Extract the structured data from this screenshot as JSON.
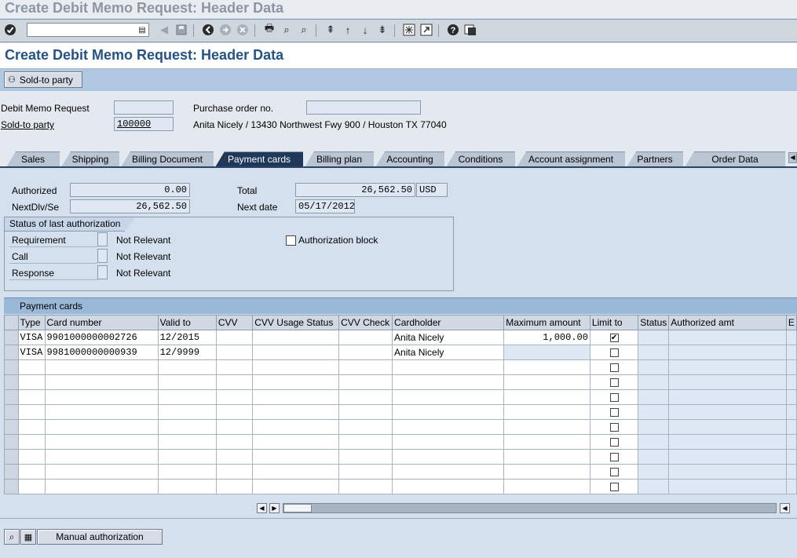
{
  "window_title": "Create Debit Memo Request: Header Data",
  "page_title": "Create Debit Memo Request: Header Data",
  "toolbar": {
    "command_field": "",
    "icons": [
      "enter-icon",
      "back-icon",
      "save-icon",
      "back-arrow-icon",
      "exit-icon",
      "cancel-icon",
      "print-icon",
      "find-icon",
      "find-next-icon",
      "first-page-icon",
      "previous-page-icon",
      "next-page-icon",
      "last-page-icon",
      "create-session-icon",
      "shortcut-icon",
      "help-icon",
      "layout-menu-icon"
    ]
  },
  "app_toolbar": {
    "sold_to_party_button": "Sold-to party"
  },
  "header": {
    "debit_memo_request_label": "Debit Memo Request",
    "debit_memo_request_value": "",
    "purchase_order_label": "Purchase order no.",
    "purchase_order_value": "",
    "sold_to_party_label": "Sold-to party",
    "sold_to_party_value": "100000",
    "sold_to_party_address": "Anita Nicely / 13430 Northwest Fwy 900 / Houston TX 77040"
  },
  "tabs": [
    {
      "label": "Sales",
      "active": false
    },
    {
      "label": "Shipping",
      "active": false
    },
    {
      "label": "Billing Document",
      "active": false
    },
    {
      "label": "Payment cards",
      "active": true
    },
    {
      "label": "Billing plan",
      "active": false
    },
    {
      "label": "Accounting",
      "active": false
    },
    {
      "label": "Conditions",
      "active": false
    },
    {
      "label": "Account assignment",
      "active": false
    },
    {
      "label": "Partners",
      "active": false
    },
    {
      "label": "Order Data",
      "active": false
    }
  ],
  "payment": {
    "authorized_label": "Authorized",
    "authorized_value": "0.00",
    "next_dlv_label": "NextDlv/Se",
    "next_dlv_value": "26,562.50",
    "total_label": "Total",
    "total_value": "26,562.50",
    "currency": "USD",
    "next_date_label": "Next date",
    "next_date_value": "05/17/2012"
  },
  "status_group": {
    "title": "Status of last authorization",
    "rows": [
      {
        "label": "Requirement",
        "value": "Not Relevant"
      },
      {
        "label": "Call",
        "value": "Not Relevant"
      },
      {
        "label": "Response",
        "value": "Not Relevant"
      }
    ],
    "authorization_block_label": "Authorization block",
    "authorization_block_checked": false
  },
  "cards_table": {
    "title": "Payment cards",
    "columns": [
      "Type",
      "Card number",
      "Valid to",
      "CVV",
      "CVV Usage Status",
      "CVV Check",
      "Cardholder",
      "Maximum amount",
      "Limit to",
      "Status",
      "Authorized amt",
      "E"
    ],
    "rows": [
      {
        "type": "VISA",
        "card_number": "9901000000002726",
        "valid_to": "12/2015",
        "cvv": "",
        "cvv_usage": "",
        "cvv_check": "",
        "cardholder": "Anita Nicely",
        "max_amount": "1,000.00",
        "limit_to": true,
        "status": "",
        "authorized_amt": ""
      },
      {
        "type": "VISA",
        "card_number": "9981000000000939",
        "valid_to": "12/9999",
        "cvv": "",
        "cvv_usage": "",
        "cvv_check": "",
        "cardholder": "Anita Nicely",
        "max_amount": "",
        "limit_to": false,
        "status": "",
        "authorized_amt": ""
      }
    ],
    "empty_rows": 9
  },
  "bottom": {
    "manual_authorization_button": "Manual authorization"
  }
}
